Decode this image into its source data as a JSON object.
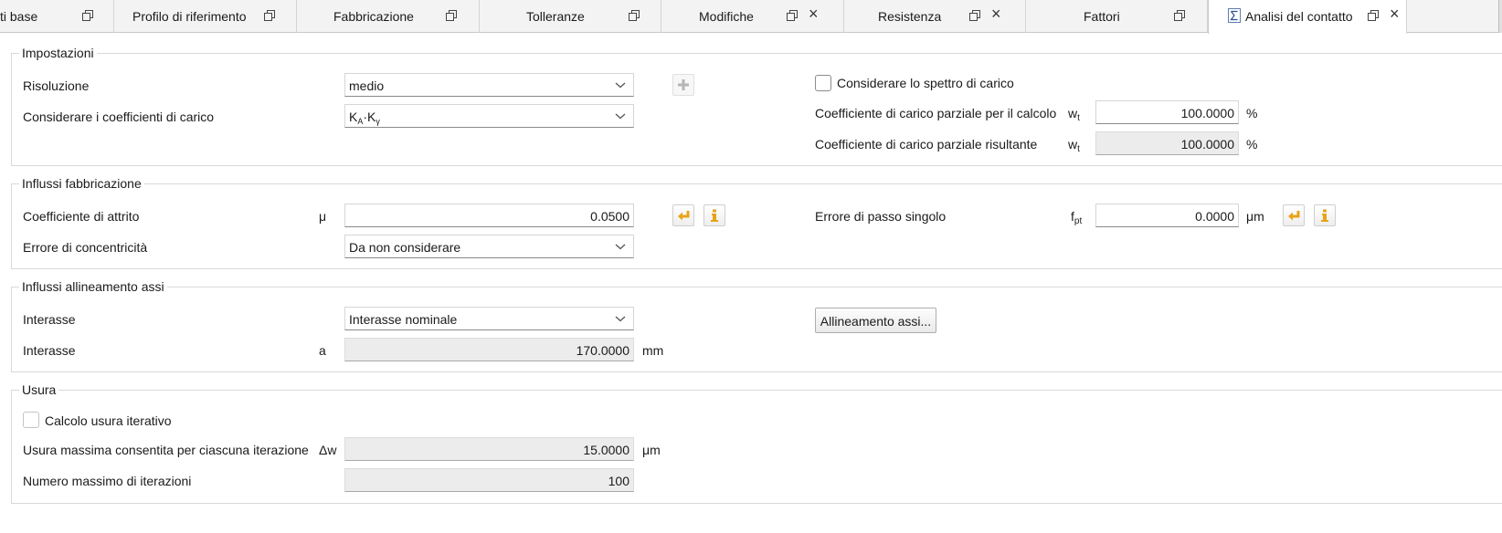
{
  "tabs": [
    {
      "label": "ti base"
    },
    {
      "label": "Profilo di riferimento"
    },
    {
      "label": "Fabbricazione"
    },
    {
      "label": "Tolleranze"
    },
    {
      "label": "Modifiche"
    },
    {
      "label": "Resistenza"
    },
    {
      "label": "Fattori"
    },
    {
      "label": "Analisi del contatto"
    }
  ],
  "settings": {
    "title": "Impostazioni",
    "resolution_label": "Risoluzione",
    "resolution_value": "medio",
    "load_coeff_label": "Considerare i coefficienti di carico",
    "load_coeff_value_main1": "K",
    "load_coeff_value_sub1": "A",
    "load_coeff_value_dot": "·K",
    "load_coeff_value_sub2": "γ",
    "spectrum_label": "Considerare lo spettro di carico",
    "partial_calc_label": "Coefficiente di carico parziale per il calcolo",
    "partial_calc_sym": "w",
    "partial_calc_sym_sub": "t",
    "partial_calc_value": "100.0000",
    "partial_calc_unit": "%",
    "partial_result_label": "Coefficiente di carico parziale risultante",
    "partial_result_sym": "w",
    "partial_result_sym_sub": "t",
    "partial_result_value": "100.0000",
    "partial_result_unit": "%"
  },
  "manufacturing": {
    "title": "Influssi fabbricazione",
    "friction_label": "Coefficiente di attrito",
    "friction_sym": "μ",
    "friction_value": "0.0500",
    "concentricity_label": "Errore di concentricità",
    "concentricity_value": "Da non considerare",
    "pitch_error_label": "Errore di passo singolo",
    "pitch_error_sym": "f",
    "pitch_error_sym_sub": "pt",
    "pitch_error_value": "0.0000",
    "pitch_error_unit": "μm"
  },
  "alignment": {
    "title": "Influssi allineamento assi",
    "center_distance_label": "Interasse",
    "center_distance_value": "Interasse nominale",
    "center_distance2_label": "Interasse",
    "center_distance2_sym": "a",
    "center_distance2_value": "170.0000",
    "center_distance2_unit": "mm",
    "alignment_button": "Allineamento assi..."
  },
  "wear": {
    "title": "Usura",
    "iterative_label": "Calcolo usura iterativo",
    "max_wear_label": "Usura massima consentita per ciascuna iterazione",
    "max_wear_sym": "Δw",
    "max_wear_value": "15.0000",
    "max_wear_unit": "μm",
    "max_iter_label": "Numero massimo di iterazioni",
    "max_iter_value": "100"
  },
  "colors": {
    "accent_arrow": "#e8a317",
    "tab_bg": "#f3f3f3",
    "readonly_bg": "#ececec"
  }
}
